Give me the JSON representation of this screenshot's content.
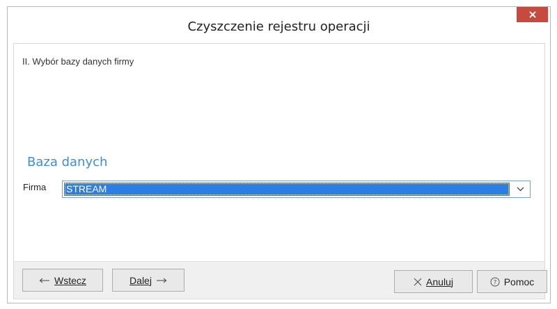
{
  "window": {
    "title": "Czyszczenie rejestru operacji",
    "close_icon": "close-icon"
  },
  "content": {
    "step_label": "II. Wybór bazy danych firmy",
    "section_title": "Baza danych",
    "firm_label": "Firma",
    "firm_selected": "STREAM"
  },
  "footer": {
    "back_label": "Wstecz",
    "next_label": "Dalej",
    "cancel_label": "Anuluj",
    "help_label": "Pomoc"
  },
  "colors": {
    "accent": "#3b8fd6",
    "selection": "#2d7de6",
    "close_button": "#c74a3f"
  }
}
